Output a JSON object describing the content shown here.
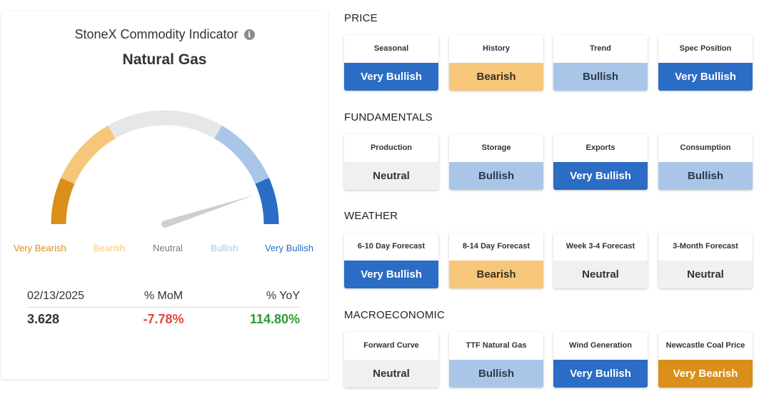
{
  "indicator": {
    "title": "StoneX Commodity Indicator",
    "subtitle": "Natural Gas",
    "info_icon": "info-icon",
    "gauge": {
      "labels": [
        "Very Bearish",
        "Bearish",
        "Neutral",
        "Bullish",
        "Very Bullish"
      ],
      "label_colors": [
        "#d98f1a",
        "#f6c77a",
        "#7a7a7a",
        "#a9c6e8",
        "#2b6cc4"
      ],
      "segment_colors": [
        "#d98f1a",
        "#f6c77a",
        "#e6e8e8",
        "#a9c6e8",
        "#2b6cc4"
      ],
      "needle_level": 0.9
    },
    "stats": {
      "date": "02/13/2025",
      "mom_label": "% MoM",
      "yoy_label": "% YoY",
      "price": "3.628",
      "mom": "-7.78%",
      "yoy": "114.80%",
      "mom_color": "#e04a3f",
      "yoy_color": "#2e9a3a"
    }
  },
  "sections": [
    {
      "title": "PRICE",
      "tiles": [
        {
          "label": "Seasonal",
          "value": "Very Bullish",
          "state": "very-bullish"
        },
        {
          "label": "History",
          "value": "Bearish",
          "state": "bearish"
        },
        {
          "label": "Trend",
          "value": "Bullish",
          "state": "bullish"
        },
        {
          "label": "Spec Position",
          "value": "Very Bullish",
          "state": "very-bullish"
        }
      ]
    },
    {
      "title": "FUNDAMENTALS",
      "tiles": [
        {
          "label": "Production",
          "value": "Neutral",
          "state": "neutral"
        },
        {
          "label": "Storage",
          "value": "Bullish",
          "state": "bullish"
        },
        {
          "label": "Exports",
          "value": "Very Bullish",
          "state": "very-bullish"
        },
        {
          "label": "Consumption",
          "value": "Bullish",
          "state": "bullish"
        }
      ]
    },
    {
      "title": "WEATHER",
      "tiles": [
        {
          "label": "6-10 Day Forecast",
          "value": "Very Bullish",
          "state": "very-bullish"
        },
        {
          "label": "8-14 Day Forecast",
          "value": "Bearish",
          "state": "bearish"
        },
        {
          "label": "Week 3-4 Forecast",
          "value": "Neutral",
          "state": "neutral"
        },
        {
          "label": "3-Month Forecast",
          "value": "Neutral",
          "state": "neutral"
        }
      ]
    },
    {
      "title": "MACROECONOMIC",
      "tiles": [
        {
          "label": "Forward Curve",
          "value": "Neutral",
          "state": "neutral"
        },
        {
          "label": "TTF Natural Gas",
          "value": "Bullish",
          "state": "bullish"
        },
        {
          "label": "Wind Generation",
          "value": "Very Bullish",
          "state": "very-bullish"
        },
        {
          "label": "Newcastle Coal Price",
          "value": "Very Bearish",
          "state": "very-bearish"
        }
      ]
    }
  ]
}
